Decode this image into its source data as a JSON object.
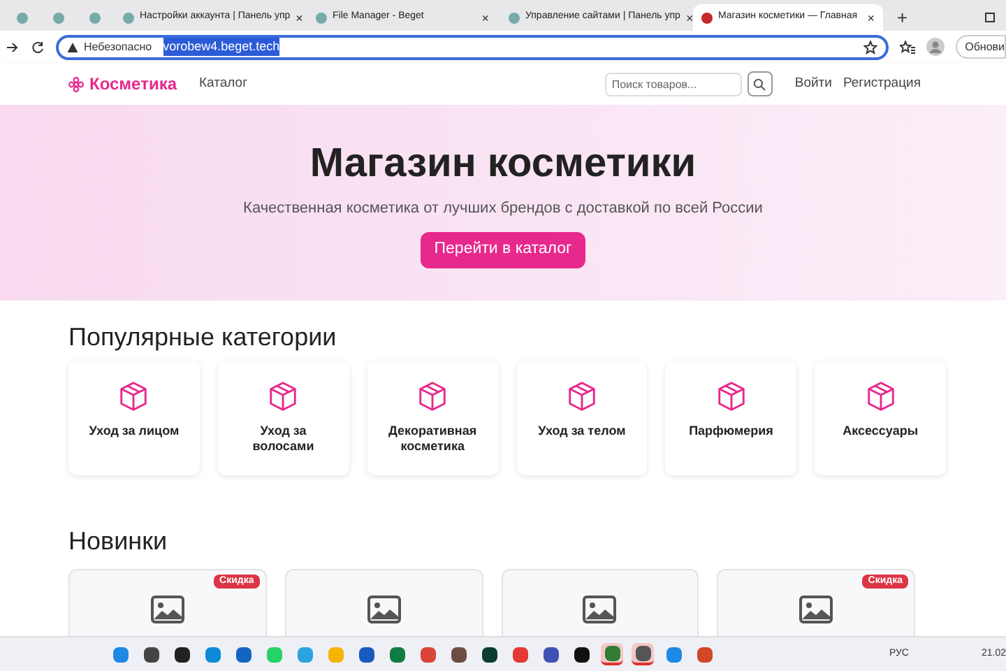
{
  "browser": {
    "tabs": [
      {
        "kind": "pinned",
        "selected": false
      },
      {
        "kind": "pinned",
        "selected": false
      },
      {
        "kind": "pinned",
        "selected": false
      },
      {
        "kind": "full",
        "title": "Настройки аккаунта | Панель упр",
        "close": "×",
        "selected": false
      },
      {
        "kind": "full",
        "title": "File Manager - Beget",
        "close": "×",
        "selected": false
      },
      {
        "kind": "full",
        "title": "Управление сайтами | Панель упр",
        "close": "×",
        "selected": false
      },
      {
        "kind": "full",
        "title": "Магазин косметики — Главная",
        "close": "×",
        "selected": true
      }
    ],
    "new_tab": "+",
    "address_bar": {
      "security": "Небезопасно",
      "url": "vorobew4.beget.tech",
      "url_selected": true
    },
    "update_button": "Обнови"
  },
  "site": {
    "nav": {
      "logo": "Косметика",
      "links": [
        "Каталог"
      ],
      "search_placeholder": "Поиск товаров...",
      "auth": [
        "Войти",
        "Регистрация"
      ]
    },
    "hero": {
      "title": "Магазин косметики",
      "subtitle": "Качественная косметика от лучших брендов с доставкой по всей России",
      "button": "Перейти в каталог"
    },
    "categories": {
      "heading": "Популярные категории",
      "items": [
        "Уход за лицом",
        "Уход за волосами",
        "Декоративная косметика",
        "Уход за телом",
        "Парфюмерия",
        "Аксессуары"
      ]
    },
    "new_products": {
      "heading": "Новинки",
      "cards": [
        {
          "kind": "discount",
          "badge": "Скидка"
        },
        {
          "kind": "plain"
        },
        {
          "kind": "plain"
        },
        {
          "kind": "discount",
          "badge": "Скидка"
        }
      ]
    }
  },
  "taskbar": {
    "apps": [
      {
        "color": "#1e88e5",
        "active": false
      },
      {
        "color": "#444444",
        "active": false
      },
      {
        "color": "#222222",
        "active": false
      },
      {
        "color": "#0c8ad8",
        "active": false
      },
      {
        "color": "#1565c0",
        "active": false
      },
      {
        "color": "#25d366",
        "active": false
      },
      {
        "color": "#2aa3e0",
        "active": false
      },
      {
        "color": "#f4b400",
        "active": false
      },
      {
        "color": "#185abd",
        "active": false
      },
      {
        "color": "#107c41",
        "active": false
      },
      {
        "color": "#db4437",
        "active": false
      },
      {
        "color": "#6d4c41",
        "active": false
      },
      {
        "color": "#0b3d2e",
        "active": false
      },
      {
        "color": "#e53935",
        "active": false
      },
      {
        "color": "#3f51b5",
        "active": false
      },
      {
        "color": "#111111",
        "active": false
      },
      {
        "color": "#2e7d32",
        "active": true
      },
      {
        "color": "#555555",
        "active": true
      },
      {
        "color": "#1e88e5",
        "active": false
      },
      {
        "color": "#d24726",
        "active": false
      }
    ],
    "language": "РУС",
    "clock": "21.02"
  }
}
